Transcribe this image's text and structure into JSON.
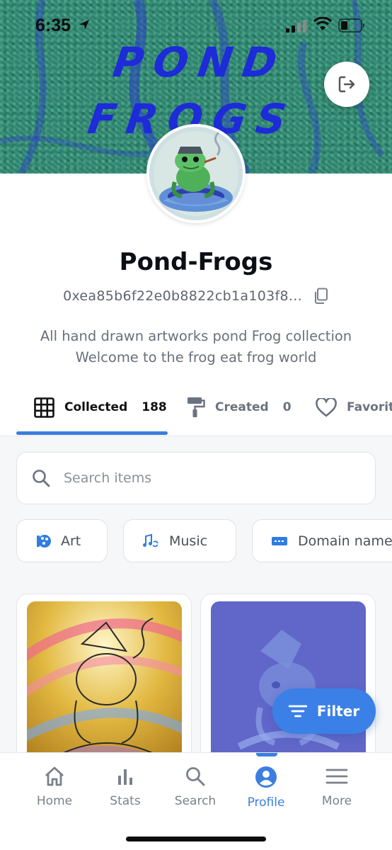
{
  "status_bar": {
    "time": "6:35"
  },
  "banner": {
    "title": "POND FROGS"
  },
  "profile": {
    "name": "Pond-Frogs",
    "address": "0xea85b6f22e0b8822cb1a103f8...",
    "bio_line1": "All hand drawn artworks pond Frog collection",
    "bio_line2": "Welcome to the frog eat frog world"
  },
  "tabs": [
    {
      "label": "Collected",
      "count": "188",
      "icon": "grid-icon",
      "active": true
    },
    {
      "label": "Created",
      "count": "0",
      "icon": "paint-roller-icon",
      "active": false
    },
    {
      "label": "Favorites",
      "icon": "heart-icon",
      "active": false
    }
  ],
  "search": {
    "placeholder": "Search items"
  },
  "categories": [
    {
      "label": "Art",
      "icon": "art-icon"
    },
    {
      "label": "Music",
      "icon": "music-icon"
    },
    {
      "label": "Domain names",
      "icon": "domain-icon"
    }
  ],
  "filter": {
    "label": "Filter"
  },
  "nav": [
    {
      "label": "Home",
      "icon": "home-icon"
    },
    {
      "label": "Stats",
      "icon": "stats-icon"
    },
    {
      "label": "Search",
      "icon": "search-icon"
    },
    {
      "label": "Profile",
      "icon": "profile-icon",
      "active": true
    },
    {
      "label": "More",
      "icon": "menu-icon"
    }
  ],
  "colors": {
    "accent": "#3b7ee0",
    "banner": "#2f8a73",
    "banner_text": "#1d2bd8",
    "card2_bg": "#6166c9"
  }
}
